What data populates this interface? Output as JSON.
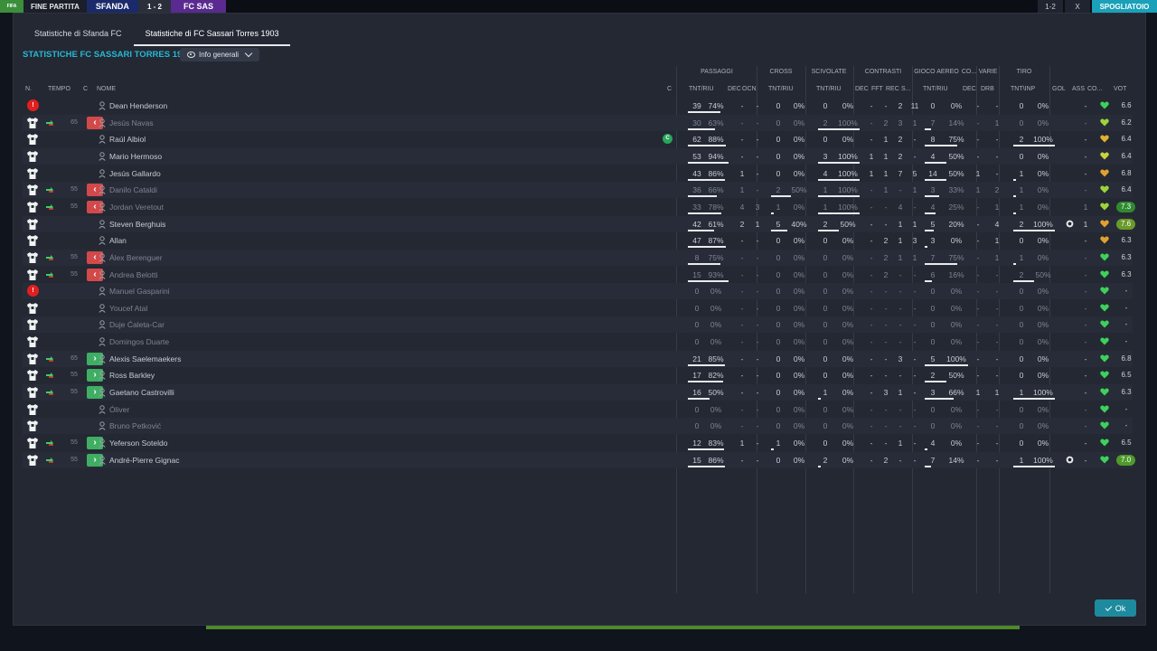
{
  "topbar": {
    "logo": "FIFA",
    "end_match": "FINE PARTITA",
    "team1": "SFANDA",
    "score": "1 - 2",
    "team2": "FC SAS",
    "right_mini1": "1-2",
    "right_mini2": "X",
    "right_button": "SPOGLIATOIO"
  },
  "tabs": [
    {
      "label": "Statistiche di Sfanda FC",
      "active": false
    },
    {
      "label": "Statistiche di FC Sassari Torres 1903",
      "active": true
    }
  ],
  "section_title": "STATISTICHE FC SASSARI TORRES 1903",
  "dropdown": {
    "label": "Info generali"
  },
  "groups": {
    "passaggi": "PASSAGGI",
    "cross": "CROSS",
    "scivolate": "SCIVOLATE",
    "contrasti": "CONTRASTI",
    "gioco_aereo": "GIOCO AEREO",
    "co": "CO...",
    "varie": "VARIE",
    "tiro": "TIRO"
  },
  "headers": {
    "n": "N.",
    "tempo": "TEMPO",
    "c": "C",
    "nome": "NOME",
    "c2": "C",
    "pass_tnt": "TNT/RIU",
    "pass_dec": "DEC",
    "pass_ocn": "OCN",
    "cross_tnt": "TNT/RIU",
    "sciv_tnt": "TNT/RIU",
    "con_dec": "DEC",
    "con_fft": "FFT",
    "con_rec": "REC",
    "con_s": "S...",
    "aereo_tnt": "TNT/RIU",
    "co_dec": "DEC",
    "varie_drb": "DRB",
    "tiro_tnt": "TNT\\INP",
    "gol": "GOL",
    "ass": "ASS",
    "co2": "CO...",
    "vot": "VOT"
  },
  "players": [
    {
      "n": "!",
      "red": true,
      "tempo": "",
      "sub": "",
      "name": "Dean Henderson",
      "dim": false,
      "captain": false,
      "p_t": "39",
      "p_r": "74%",
      "p_bar": 0.74,
      "p_dec": "-",
      "p_ocn": "-",
      "x_t": "0",
      "x_r": "0%",
      "x_bar": 0,
      "s_t": "0",
      "s_r": "0%",
      "s_bar": 0,
      "c_dec": "-",
      "c_fft": "-",
      "c_rec": "2",
      "c_s": "11",
      "a_t": "0",
      "a_r": "0%",
      "a_bar": 0,
      "co_dec": "-",
      "drb": "-",
      "t_t": "0",
      "t_r": "0%",
      "t_bar": 0,
      "gol": "",
      "ass": "-",
      "heart": "#3dd15a",
      "vote": "6.6",
      "vote_badge": ""
    },
    {
      "n": "",
      "red": false,
      "tempo": "65",
      "sub": "out",
      "name": "Jesús Navas",
      "dim": true,
      "captain": false,
      "p_t": "30",
      "p_r": "63%",
      "p_bar": 0.63,
      "p_dec": "-",
      "p_ocn": "-",
      "x_t": "0",
      "x_r": "0%",
      "x_bar": 0,
      "s_t": "2",
      "s_r": "100%",
      "s_bar": 1,
      "c_dec": "-",
      "c_fft": "2",
      "c_rec": "3",
      "c_s": "1",
      "a_t": "7",
      "a_r": "14%",
      "a_bar": 0.14,
      "co_dec": "-",
      "drb": "1",
      "t_t": "0",
      "t_r": "0%",
      "t_bar": 0,
      "gol": "",
      "ass": "-",
      "heart": "#9bd43a",
      "vote": "6.2",
      "vote_badge": ""
    },
    {
      "n": "",
      "red": false,
      "tempo": "",
      "sub": "",
      "name": "Raúl Albiol",
      "dim": false,
      "captain": true,
      "p_t": "62",
      "p_r": "88%",
      "p_bar": 0.88,
      "p_dec": "-",
      "p_ocn": "-",
      "x_t": "0",
      "x_r": "0%",
      "x_bar": 0,
      "s_t": "0",
      "s_r": "0%",
      "s_bar": 0,
      "c_dec": "-",
      "c_fft": "1",
      "c_rec": "2",
      "c_s": "-",
      "a_t": "8",
      "a_r": "75%",
      "a_bar": 0.75,
      "co_dec": "-",
      "drb": "-",
      "t_t": "2",
      "t_r": "100%",
      "t_bar": 1,
      "gol": "",
      "ass": "-",
      "heart": "#e0b030",
      "vote": "6.4",
      "vote_badge": ""
    },
    {
      "n": "",
      "red": false,
      "tempo": "",
      "sub": "",
      "name": "Mario Hermoso",
      "dim": false,
      "captain": false,
      "p_t": "53",
      "p_r": "94%",
      "p_bar": 0.94,
      "p_dec": "-",
      "p_ocn": "-",
      "x_t": "0",
      "x_r": "0%",
      "x_bar": 0,
      "s_t": "3",
      "s_r": "100%",
      "s_bar": 1,
      "c_dec": "1",
      "c_fft": "1",
      "c_rec": "2",
      "c_s": "-",
      "a_t": "4",
      "a_r": "50%",
      "a_bar": 0.5,
      "co_dec": "-",
      "drb": "-",
      "t_t": "0",
      "t_r": "0%",
      "t_bar": 0,
      "gol": "",
      "ass": "-",
      "heart": "#c9d23a",
      "vote": "6.4",
      "vote_badge": ""
    },
    {
      "n": "",
      "red": false,
      "tempo": "",
      "sub": "",
      "name": "Jesús Gallardo",
      "dim": false,
      "captain": false,
      "p_t": "43",
      "p_r": "86%",
      "p_bar": 0.86,
      "p_dec": "1",
      "p_ocn": "-",
      "x_t": "0",
      "x_r": "0%",
      "x_bar": 0,
      "s_t": "4",
      "s_r": "100%",
      "s_bar": 1,
      "c_dec": "1",
      "c_fft": "1",
      "c_rec": "7",
      "c_s": "5",
      "a_t": "14",
      "a_r": "50%",
      "a_bar": 0.5,
      "co_dec": "1",
      "drb": "-",
      "t_t": "1",
      "t_r": "0%",
      "t_bar": 0,
      "gol": "",
      "ass": "-",
      "heart": "#e0a030",
      "vote": "6.8",
      "vote_badge": ""
    },
    {
      "n": "",
      "red": false,
      "tempo": "55",
      "sub": "out",
      "name": "Danilo Cataldi",
      "dim": true,
      "captain": false,
      "p_t": "36",
      "p_r": "66%",
      "p_bar": 0.66,
      "p_dec": "1",
      "p_ocn": "-",
      "x_t": "2",
      "x_r": "50%",
      "x_bar": 0.5,
      "s_t": "1",
      "s_r": "100%",
      "s_bar": 1,
      "c_dec": "-",
      "c_fft": "1",
      "c_rec": "-",
      "c_s": "1",
      "a_t": "3",
      "a_r": "33%",
      "a_bar": 0.33,
      "co_dec": "1",
      "drb": "2",
      "t_t": "1",
      "t_r": "0%",
      "t_bar": 0,
      "gol": "",
      "ass": "-",
      "heart": "#9bd43a",
      "vote": "6.4",
      "vote_badge": ""
    },
    {
      "n": "",
      "red": false,
      "tempo": "55",
      "sub": "out",
      "name": "Jordan Veretout",
      "dim": true,
      "captain": false,
      "p_t": "33",
      "p_r": "78%",
      "p_bar": 0.78,
      "p_dec": "4",
      "p_ocn": "3",
      "x_t": "1",
      "x_r": "0%",
      "x_bar": 0,
      "s_t": "1",
      "s_r": "100%",
      "s_bar": 1,
      "c_dec": "-",
      "c_fft": "-",
      "c_rec": "4",
      "c_s": "-",
      "a_t": "4",
      "a_r": "25%",
      "a_bar": 0.25,
      "co_dec": "-",
      "drb": "1",
      "t_t": "1",
      "t_r": "0%",
      "t_bar": 0,
      "gol": "",
      "ass": "1",
      "heart": "#9bd43a",
      "vote": "7.3",
      "vote_badge": "#2f8a2f"
    },
    {
      "n": "",
      "red": false,
      "tempo": "",
      "sub": "",
      "name": "Steven Berghuis",
      "dim": false,
      "captain": false,
      "p_t": "42",
      "p_r": "61%",
      "p_bar": 0.61,
      "p_dec": "2",
      "p_ocn": "1",
      "x_t": "5",
      "x_r": "40%",
      "x_bar": 0.4,
      "s_t": "2",
      "s_r": "50%",
      "s_bar": 0.5,
      "c_dec": "-",
      "c_fft": "-",
      "c_rec": "1",
      "c_s": "1",
      "a_t": "5",
      "a_r": "20%",
      "a_bar": 0.2,
      "co_dec": "-",
      "drb": "4",
      "t_t": "2",
      "t_r": "100%",
      "t_bar": 1,
      "gol": "ball",
      "ass": "1",
      "heart": "#e0a030",
      "vote": "7.6",
      "vote_badge": "#6a9a2a"
    },
    {
      "n": "",
      "red": false,
      "tempo": "",
      "sub": "",
      "name": "Allan",
      "dim": false,
      "captain": false,
      "p_t": "47",
      "p_r": "87%",
      "p_bar": 0.87,
      "p_dec": "-",
      "p_ocn": "-",
      "x_t": "0",
      "x_r": "0%",
      "x_bar": 0,
      "s_t": "0",
      "s_r": "0%",
      "s_bar": 0,
      "c_dec": "-",
      "c_fft": "2",
      "c_rec": "1",
      "c_s": "3",
      "a_t": "3",
      "a_r": "0%",
      "a_bar": 0,
      "co_dec": "-",
      "drb": "1",
      "t_t": "0",
      "t_r": "0%",
      "t_bar": 0,
      "gol": "",
      "ass": "-",
      "heart": "#e0a030",
      "vote": "6.3",
      "vote_badge": ""
    },
    {
      "n": "",
      "red": false,
      "tempo": "55",
      "sub": "out",
      "name": "Álex Berenguer",
      "dim": true,
      "captain": false,
      "p_t": "8",
      "p_r": "75%",
      "p_bar": 0.75,
      "p_dec": "-",
      "p_ocn": "-",
      "x_t": "0",
      "x_r": "0%",
      "x_bar": 0,
      "s_t": "0",
      "s_r": "0%",
      "s_bar": 0,
      "c_dec": "-",
      "c_fft": "2",
      "c_rec": "1",
      "c_s": "1",
      "a_t": "7",
      "a_r": "75%",
      "a_bar": 0.75,
      "co_dec": "-",
      "drb": "1",
      "t_t": "1",
      "t_r": "0%",
      "t_bar": 0,
      "gol": "",
      "ass": "-",
      "heart": "#3dd15a",
      "vote": "6.3",
      "vote_badge": ""
    },
    {
      "n": "",
      "red": false,
      "tempo": "55",
      "sub": "out",
      "name": "Andrea Belotti",
      "dim": true,
      "captain": false,
      "p_t": "15",
      "p_r": "93%",
      "p_bar": 0.93,
      "p_dec": "-",
      "p_ocn": "-",
      "x_t": "0",
      "x_r": "0%",
      "x_bar": 0,
      "s_t": "0",
      "s_r": "0%",
      "s_bar": 0,
      "c_dec": "-",
      "c_fft": "2",
      "c_rec": "-",
      "c_s": "-",
      "a_t": "6",
      "a_r": "16%",
      "a_bar": 0.16,
      "co_dec": "-",
      "drb": "-",
      "t_t": "2",
      "t_r": "50%",
      "t_bar": 0.5,
      "gol": "",
      "ass": "-",
      "heart": "#3dd15a",
      "vote": "6.3",
      "vote_badge": ""
    },
    {
      "n": "!",
      "red": true,
      "tempo": "",
      "sub": "",
      "name": "Manuel Gasparini",
      "dim": true,
      "captain": false,
      "p_t": "0",
      "p_r": "0%",
      "p_bar": 0,
      "p_dec": "-",
      "p_ocn": "-",
      "x_t": "0",
      "x_r": "0%",
      "x_bar": 0,
      "s_t": "0",
      "s_r": "0%",
      "s_bar": 0,
      "c_dec": "-",
      "c_fft": "-",
      "c_rec": "-",
      "c_s": "-",
      "a_t": "0",
      "a_r": "0%",
      "a_bar": 0,
      "co_dec": "-",
      "drb": "-",
      "t_t": "0",
      "t_r": "0%",
      "t_bar": 0,
      "gol": "",
      "ass": "-",
      "heart": "#3dd15a",
      "vote": "-",
      "vote_badge": ""
    },
    {
      "n": "",
      "red": false,
      "tempo": "",
      "sub": "",
      "name": "Youcef Atal",
      "dim": true,
      "captain": false,
      "p_t": "0",
      "p_r": "0%",
      "p_bar": 0,
      "p_dec": "-",
      "p_ocn": "-",
      "x_t": "0",
      "x_r": "0%",
      "x_bar": 0,
      "s_t": "0",
      "s_r": "0%",
      "s_bar": 0,
      "c_dec": "-",
      "c_fft": "-",
      "c_rec": "-",
      "c_s": "-",
      "a_t": "0",
      "a_r": "0%",
      "a_bar": 0,
      "co_dec": "-",
      "drb": "-",
      "t_t": "0",
      "t_r": "0%",
      "t_bar": 0,
      "gol": "",
      "ass": "-",
      "heart": "#3dd15a",
      "vote": "-",
      "vote_badge": ""
    },
    {
      "n": "",
      "red": false,
      "tempo": "",
      "sub": "",
      "name": "Duje Ćaleta-Car",
      "dim": true,
      "captain": false,
      "p_t": "0",
      "p_r": "0%",
      "p_bar": 0,
      "p_dec": "-",
      "p_ocn": "-",
      "x_t": "0",
      "x_r": "0%",
      "x_bar": 0,
      "s_t": "0",
      "s_r": "0%",
      "s_bar": 0,
      "c_dec": "-",
      "c_fft": "-",
      "c_rec": "-",
      "c_s": "-",
      "a_t": "0",
      "a_r": "0%",
      "a_bar": 0,
      "co_dec": "-",
      "drb": "-",
      "t_t": "0",
      "t_r": "0%",
      "t_bar": 0,
      "gol": "",
      "ass": "-",
      "heart": "#3dd15a",
      "vote": "-",
      "vote_badge": ""
    },
    {
      "n": "",
      "red": false,
      "tempo": "",
      "sub": "",
      "name": "Domingos Duarte",
      "dim": true,
      "captain": false,
      "p_t": "0",
      "p_r": "0%",
      "p_bar": 0,
      "p_dec": "-",
      "p_ocn": "-",
      "x_t": "0",
      "x_r": "0%",
      "x_bar": 0,
      "s_t": "0",
      "s_r": "0%",
      "s_bar": 0,
      "c_dec": "-",
      "c_fft": "-",
      "c_rec": "-",
      "c_s": "-",
      "a_t": "0",
      "a_r": "0%",
      "a_bar": 0,
      "co_dec": "-",
      "drb": "-",
      "t_t": "0",
      "t_r": "0%",
      "t_bar": 0,
      "gol": "",
      "ass": "-",
      "heart": "#3dd15a",
      "vote": "-",
      "vote_badge": ""
    },
    {
      "n": "",
      "red": false,
      "tempo": "65",
      "sub": "in",
      "name": "Alexis Saelemaekers",
      "dim": false,
      "captain": false,
      "p_t": "21",
      "p_r": "85%",
      "p_bar": 0.85,
      "p_dec": "-",
      "p_ocn": "-",
      "x_t": "0",
      "x_r": "0%",
      "x_bar": 0,
      "s_t": "0",
      "s_r": "0%",
      "s_bar": 0,
      "c_dec": "-",
      "c_fft": "-",
      "c_rec": "3",
      "c_s": "-",
      "a_t": "5",
      "a_r": "100%",
      "a_bar": 1,
      "co_dec": "-",
      "drb": "-",
      "t_t": "0",
      "t_r": "0%",
      "t_bar": 0,
      "gol": "",
      "ass": "-",
      "heart": "#3dd15a",
      "vote": "6.8",
      "vote_badge": ""
    },
    {
      "n": "",
      "red": false,
      "tempo": "55",
      "sub": "in",
      "name": "Ross Barkley",
      "dim": false,
      "captain": false,
      "p_t": "17",
      "p_r": "82%",
      "p_bar": 0.82,
      "p_dec": "-",
      "p_ocn": "-",
      "x_t": "0",
      "x_r": "0%",
      "x_bar": 0,
      "s_t": "0",
      "s_r": "0%",
      "s_bar": 0,
      "c_dec": "-",
      "c_fft": "-",
      "c_rec": "-",
      "c_s": "-",
      "a_t": "2",
      "a_r": "50%",
      "a_bar": 0.5,
      "co_dec": "-",
      "drb": "-",
      "t_t": "0",
      "t_r": "0%",
      "t_bar": 0,
      "gol": "",
      "ass": "-",
      "heart": "#3dd15a",
      "vote": "6.5",
      "vote_badge": ""
    },
    {
      "n": "",
      "red": false,
      "tempo": "55",
      "sub": "in",
      "name": "Gaetano Castrovilli",
      "dim": false,
      "captain": false,
      "p_t": "16",
      "p_r": "50%",
      "p_bar": 0.5,
      "p_dec": "-",
      "p_ocn": "-",
      "x_t": "0",
      "x_r": "0%",
      "x_bar": 0,
      "s_t": "1",
      "s_r": "0%",
      "s_bar": 0,
      "c_dec": "-",
      "c_fft": "3",
      "c_rec": "1",
      "c_s": "-",
      "a_t": "3",
      "a_r": "66%",
      "a_bar": 0.66,
      "co_dec": "1",
      "drb": "1",
      "t_t": "1",
      "t_r": "100%",
      "t_bar": 1,
      "gol": "",
      "ass": "-",
      "heart": "#3dd15a",
      "vote": "6.3",
      "vote_badge": ""
    },
    {
      "n": "",
      "red": false,
      "tempo": "",
      "sub": "",
      "name": "Óliver",
      "dim": true,
      "captain": false,
      "p_t": "0",
      "p_r": "0%",
      "p_bar": 0,
      "p_dec": "-",
      "p_ocn": "-",
      "x_t": "0",
      "x_r": "0%",
      "x_bar": 0,
      "s_t": "0",
      "s_r": "0%",
      "s_bar": 0,
      "c_dec": "-",
      "c_fft": "-",
      "c_rec": "-",
      "c_s": "-",
      "a_t": "0",
      "a_r": "0%",
      "a_bar": 0,
      "co_dec": "-",
      "drb": "-",
      "t_t": "0",
      "t_r": "0%",
      "t_bar": 0,
      "gol": "",
      "ass": "-",
      "heart": "#3dd15a",
      "vote": "-",
      "vote_badge": ""
    },
    {
      "n": "",
      "red": false,
      "tempo": "",
      "sub": "",
      "name": "Bruno Petković",
      "dim": true,
      "captain": false,
      "p_t": "0",
      "p_r": "0%",
      "p_bar": 0,
      "p_dec": "-",
      "p_ocn": "-",
      "x_t": "0",
      "x_r": "0%",
      "x_bar": 0,
      "s_t": "0",
      "s_r": "0%",
      "s_bar": 0,
      "c_dec": "-",
      "c_fft": "-",
      "c_rec": "-",
      "c_s": "-",
      "a_t": "0",
      "a_r": "0%",
      "a_bar": 0,
      "co_dec": "-",
      "drb": "-",
      "t_t": "0",
      "t_r": "0%",
      "t_bar": 0,
      "gol": "",
      "ass": "-",
      "heart": "#3dd15a",
      "vote": "-",
      "vote_badge": ""
    },
    {
      "n": "",
      "red": false,
      "tempo": "55",
      "sub": "in",
      "name": "Yeferson Soteldo",
      "dim": false,
      "captain": false,
      "p_t": "12",
      "p_r": "83%",
      "p_bar": 0.83,
      "p_dec": "1",
      "p_ocn": "-",
      "x_t": "1",
      "x_r": "0%",
      "x_bar": 0,
      "s_t": "0",
      "s_r": "0%",
      "s_bar": 0,
      "c_dec": "-",
      "c_fft": "-",
      "c_rec": "1",
      "c_s": "-",
      "a_t": "4",
      "a_r": "0%",
      "a_bar": 0,
      "co_dec": "-",
      "drb": "-",
      "t_t": "0",
      "t_r": "0%",
      "t_bar": 0,
      "gol": "",
      "ass": "-",
      "heart": "#3dd15a",
      "vote": "6.5",
      "vote_badge": ""
    },
    {
      "n": "",
      "red": false,
      "tempo": "55",
      "sub": "in",
      "name": "André-Pierre Gignac",
      "dim": false,
      "captain": false,
      "p_t": "15",
      "p_r": "86%",
      "p_bar": 0.86,
      "p_dec": "-",
      "p_ocn": "-",
      "x_t": "0",
      "x_r": "0%",
      "x_bar": 0,
      "s_t": "2",
      "s_r": "0%",
      "s_bar": 0,
      "c_dec": "-",
      "c_fft": "2",
      "c_rec": "-",
      "c_s": "-",
      "a_t": "7",
      "a_r": "14%",
      "a_bar": 0.14,
      "co_dec": "-",
      "drb": "-",
      "t_t": "1",
      "t_r": "100%",
      "t_bar": 1,
      "gol": "ball",
      "ass": "-",
      "heart": "#3dd15a",
      "vote": "7.0",
      "vote_badge": "#4f9a2a"
    }
  ],
  "ok_button": "Ok"
}
